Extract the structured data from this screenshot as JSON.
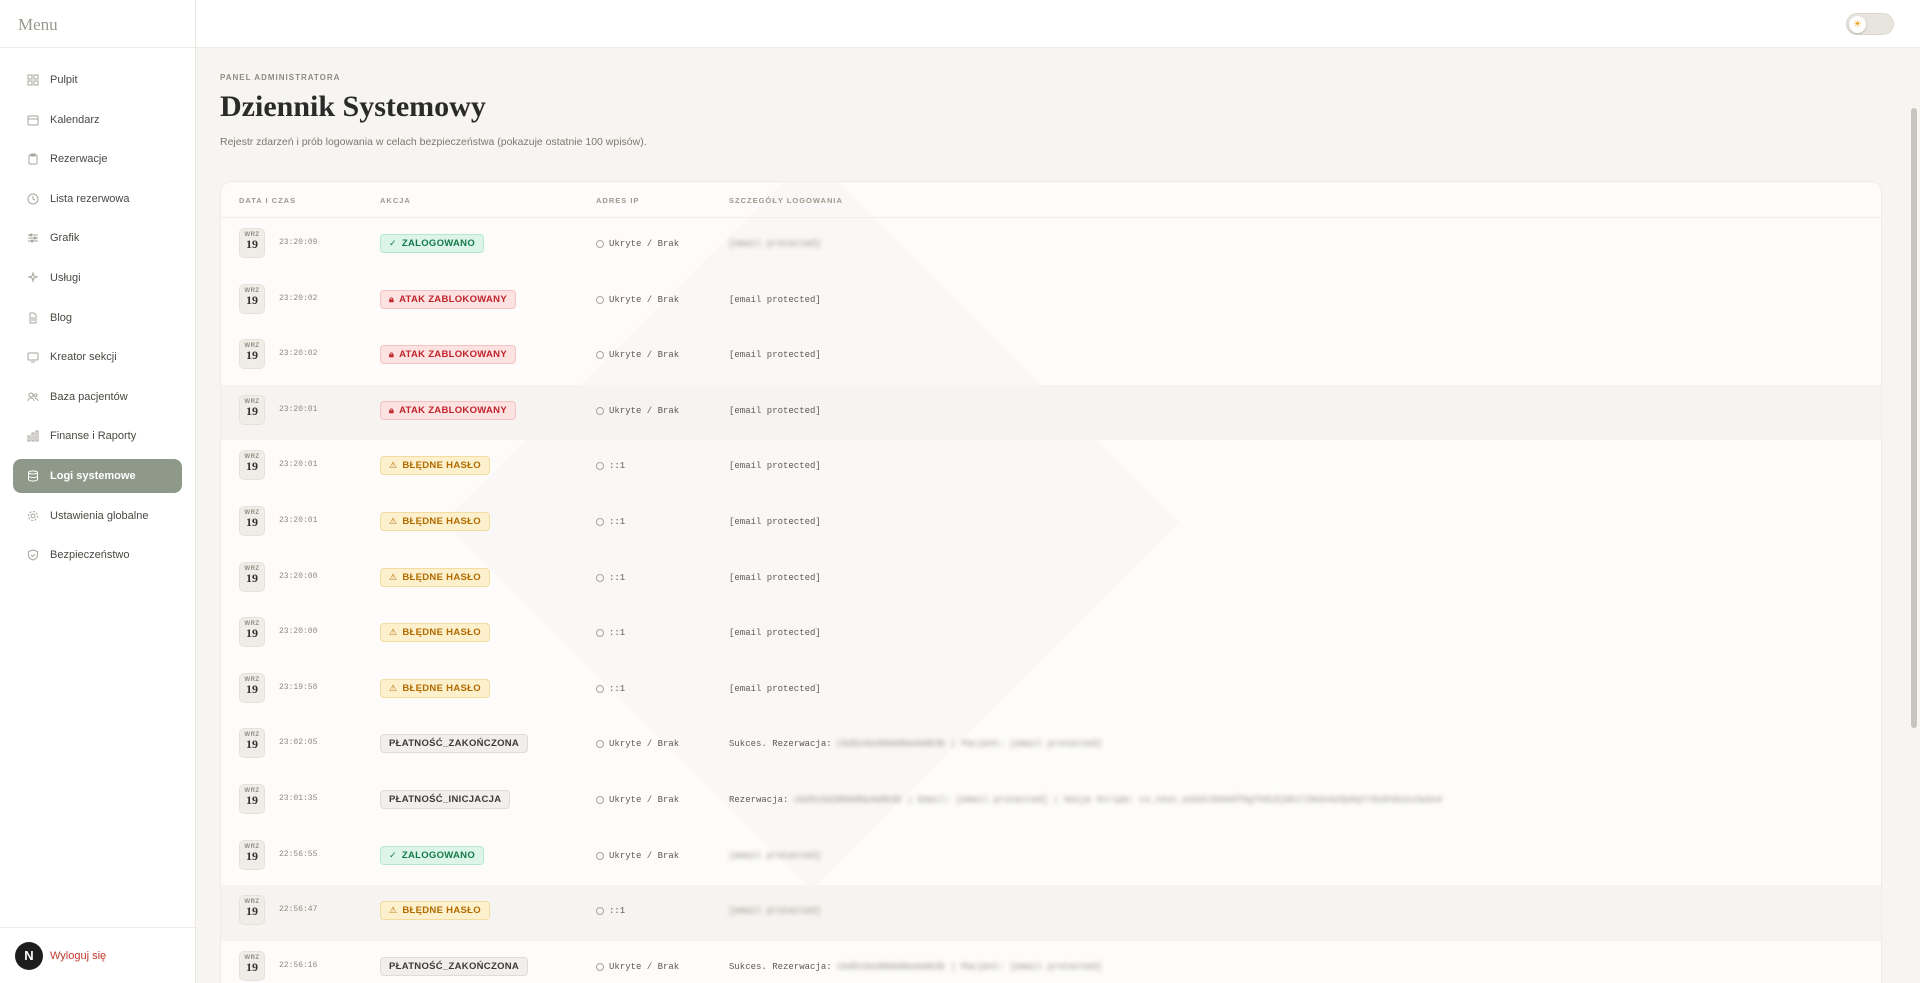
{
  "sidebar": {
    "title": "Menu",
    "items": [
      {
        "label": "Pulpit",
        "icon": "grid-icon"
      },
      {
        "label": "Kalendarz",
        "icon": "calendar-icon"
      },
      {
        "label": "Rezerwacje",
        "icon": "clipboard-icon"
      },
      {
        "label": "Lista rezerwowa",
        "icon": "clock-icon"
      },
      {
        "label": "Grafik",
        "icon": "sliders-icon"
      },
      {
        "label": "Usługi",
        "icon": "sparkles-icon"
      },
      {
        "label": "Blog",
        "icon": "document-icon"
      },
      {
        "label": "Kreator sekcji",
        "icon": "monitor-icon"
      },
      {
        "label": "Baza pacjentów",
        "icon": "users-icon"
      },
      {
        "label": "Finanse i Raporty",
        "icon": "bar-chart-icon"
      },
      {
        "label": "Logi systemowe",
        "icon": "database-icon",
        "active": true
      },
      {
        "label": "Ustawienia globalne",
        "icon": "gear-icon"
      },
      {
        "label": "Bezpieczeństwo",
        "icon": "shield-icon"
      }
    ],
    "user_initial": "N",
    "logout_label": "Wyloguj się"
  },
  "header": {
    "eyebrow": "PANEL ADMINISTRATORA",
    "title": "Dziennik Systemowy",
    "subtitle": "Rejestr zdarzeń i prób logowania w celach bezpieczeństwa (pokazuje ostatnie 100 wpisów)."
  },
  "table": {
    "columns": [
      "DATA I CZAS",
      "AKCJA",
      "ADRES IP",
      "SZCZEGÓŁY LOGOWANIA"
    ],
    "rows": [
      {
        "month": "WRZ",
        "day": "19",
        "time": "23:20:09",
        "action": "ZALOGOWANO",
        "type": "success",
        "ip": "Ukryte / Brak",
        "details": "",
        "details_blur": "[email protected]"
      },
      {
        "month": "WRZ",
        "day": "19",
        "time": "23:20:02",
        "action": "ATAK ZABLOKOWANY",
        "type": "danger",
        "ip": "Ukryte / Brak",
        "details": "[email protected]",
        "details_blur": ""
      },
      {
        "month": "WRZ",
        "day": "19",
        "time": "23:20:02",
        "action": "ATAK ZABLOKOWANY",
        "type": "danger",
        "ip": "Ukryte / Brak",
        "details": "[email protected]",
        "details_blur": ""
      },
      {
        "month": "WRZ",
        "day": "19",
        "time": "23:20:01",
        "action": "ATAK ZABLOKOWANY",
        "type": "danger",
        "ip": "Ukryte / Brak",
        "details": "[email protected]",
        "details_blur": ""
      },
      {
        "month": "WRZ",
        "day": "19",
        "time": "23:20:01",
        "action": "BŁĘDNE HASŁO",
        "type": "warn",
        "ip": "::1",
        "details": "[email protected]",
        "details_blur": ""
      },
      {
        "month": "WRZ",
        "day": "19",
        "time": "23:20:01",
        "action": "BŁĘDNE HASŁO",
        "type": "warn",
        "ip": "::1",
        "details": "[email protected]",
        "details_blur": ""
      },
      {
        "month": "WRZ",
        "day": "19",
        "time": "23:20:00",
        "action": "BŁĘDNE HASŁO",
        "type": "warn",
        "ip": "::1",
        "details": "[email protected]",
        "details_blur": ""
      },
      {
        "month": "WRZ",
        "day": "19",
        "time": "23:20:00",
        "action": "BŁĘDNE HASŁO",
        "type": "warn",
        "ip": "::1",
        "details": "[email protected]",
        "details_blur": ""
      },
      {
        "month": "WRZ",
        "day": "19",
        "time": "23:19:58",
        "action": "BŁĘDNE HASŁO",
        "type": "warn",
        "ip": "::1",
        "details": "[email protected]",
        "details_blur": ""
      },
      {
        "month": "WRZ",
        "day": "19",
        "time": "23:02:05",
        "action": "PŁATNOŚĆ_ZAKOŃCZONA",
        "type": "neutral",
        "ip": "Ukryte / Brak",
        "details": "Sukces. Rezerwacja: ",
        "details_blur": "cbd5c6a30b0d0a4a0b3b | Pacjent: [email protected]"
      },
      {
        "month": "WRZ",
        "day": "19",
        "time": "23:01:35",
        "action": "PŁATNOŚĆ_INICJACJA",
        "type": "neutral",
        "ip": "Ukryte / Brak",
        "details": "Rezerwacja: ",
        "details_blur": "cbd5c6a30b0d0a4a0b3b | Email: [email protected] | Sesja Stripe: cs_test_a1b2c3d4e5f6g7h8i9j0k1l2m3n4o5p6q7r8s9t0u1v2w3x4"
      },
      {
        "month": "WRZ",
        "day": "19",
        "time": "22:56:55",
        "action": "ZALOGOWANO",
        "type": "success",
        "ip": "Ukryte / Brak",
        "details": "",
        "details_blur": "[email protected]"
      },
      {
        "month": "WRZ",
        "day": "19",
        "time": "22:56:47",
        "action": "BŁĘDNE HASŁO",
        "type": "warn",
        "ip": "::1",
        "details": "",
        "details_blur": "[email protected]"
      },
      {
        "month": "WRZ",
        "day": "19",
        "time": "22:56:16",
        "action": "PŁATNOŚĆ_ZAKOŃCZONA",
        "type": "neutral",
        "ip": "Ukryte / Brak",
        "details": "Sukces. Rezerwacja: ",
        "details_blur": "cbd5c6a30b0d0a4a0b3b | Pacjent: [email protected]"
      }
    ]
  },
  "colors": {
    "accent": "#8f998a",
    "success": "#157a4a",
    "danger": "#c0232b",
    "warn": "#b36b00"
  }
}
